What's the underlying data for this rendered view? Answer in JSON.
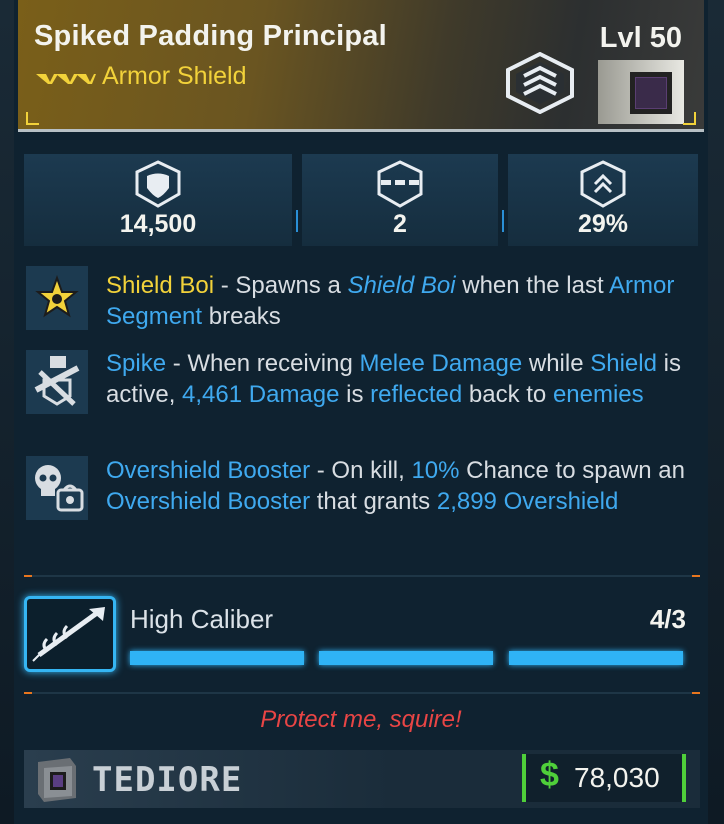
{
  "item": {
    "name": "Spiked Padding Principal",
    "type": "Armor Shield",
    "level": "Lvl 50",
    "rarity_color": "#f2d23a",
    "element_color": "#3a2b4a"
  },
  "stats": [
    {
      "icon": "shield-capacity-icon",
      "value": "14,500"
    },
    {
      "icon": "armor-segments-icon",
      "value": "2"
    },
    {
      "icon": "recharge-rate-icon",
      "value": "29%"
    }
  ],
  "perks": [
    {
      "icon": "star-burst-icon",
      "name": "Shield Boi",
      "dash": " - Spawns a ",
      "em": "Shield Boi",
      "rest1": " when the last ",
      "seg": "Armor Segment",
      "rest2": " breaks"
    },
    {
      "icon": "spike-fist-icon",
      "name": "Spike",
      "p1": " - When receiving ",
      "k1": "Melee Damage",
      "p2": " while ",
      "k2": "Shield",
      "p3": " is active, ",
      "k3": "4,461 Damage",
      "p4": " is ",
      "k4": "reflected",
      "p5": " back to ",
      "k5": "enemies"
    },
    {
      "icon": "skull-booster-icon",
      "name": "Overshield Booster",
      "p1": " - On kill, ",
      "k1": "10%",
      "p2": " Chance to spawn an ",
      "k2": "Overshield Booster",
      "p3": " that grants ",
      "k3": "2,899",
      "k4": "Overshield"
    }
  ],
  "part": {
    "icon": "high-caliber-part-icon",
    "name": "High Caliber",
    "count": "4/3",
    "segments_filled": 3
  },
  "flavor": "Protect me, squire!",
  "manufacturer": {
    "name": "TEDIORE",
    "icon": "tediore-cube-icon"
  },
  "price": {
    "symbol": "$",
    "value": "78,030",
    "color": "#4fcf3a"
  }
}
